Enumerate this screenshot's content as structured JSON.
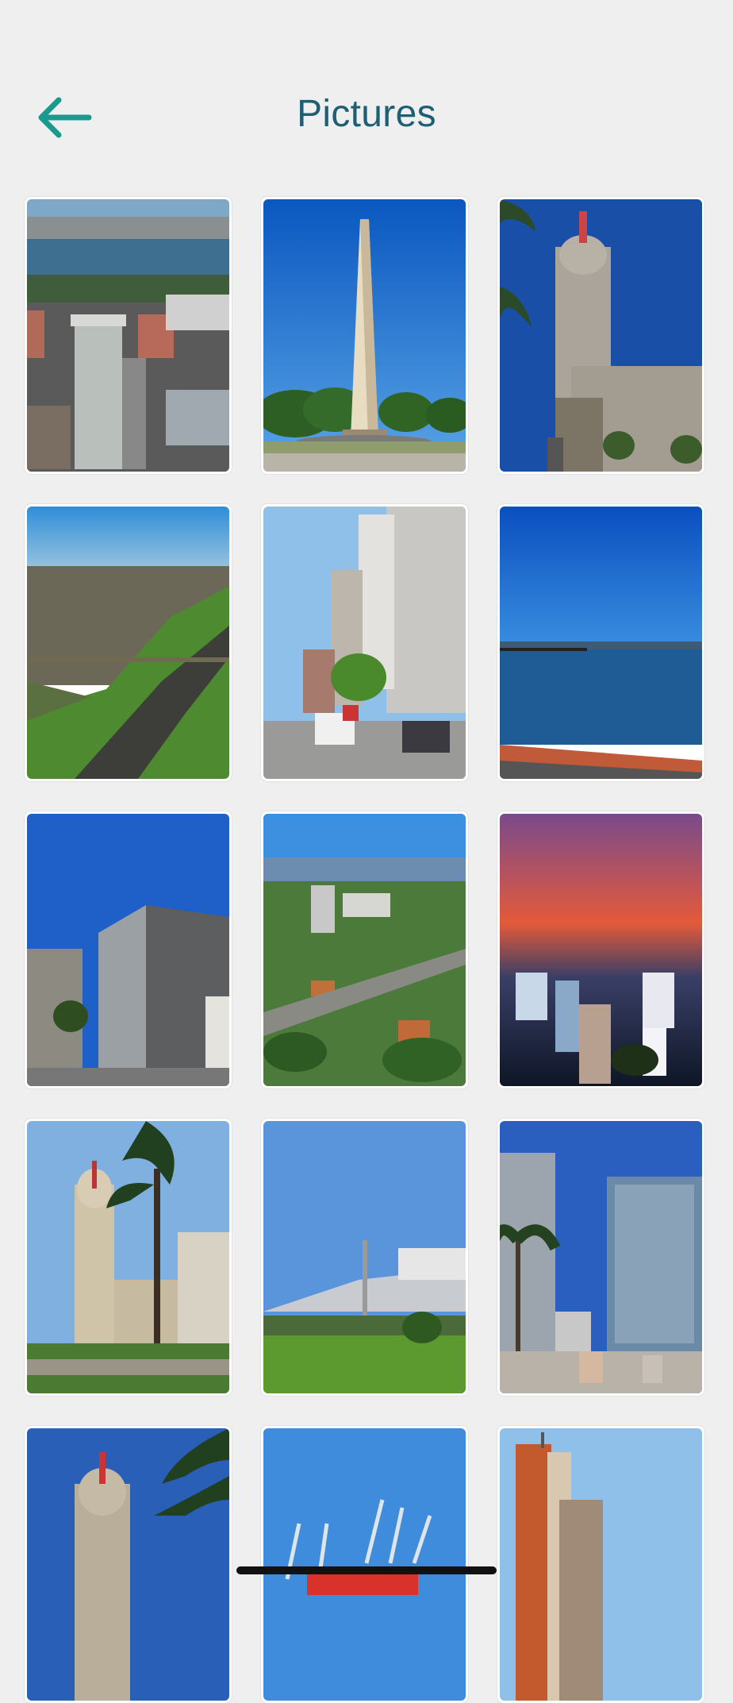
{
  "header": {
    "title": "Pictures",
    "back_icon": "arrow-left-icon",
    "accent_color": "#1a9a8e",
    "title_color": "#1d5f74"
  },
  "gallery": {
    "items": [
      {
        "subject": "aerial-city-bay"
      },
      {
        "subject": "obelisk-monument"
      },
      {
        "subject": "salvo-palace"
      },
      {
        "subject": "coastline-aerial"
      },
      {
        "subject": "street-buildings"
      },
      {
        "subject": "harbor-water"
      },
      {
        "subject": "office-buildings"
      },
      {
        "subject": "aerial-residential"
      },
      {
        "subject": "city-sunset"
      },
      {
        "subject": "palace-plaza-palms"
      },
      {
        "subject": "fortress-hill"
      },
      {
        "subject": "plaza-towers"
      },
      {
        "subject": "palace-tower-palm"
      },
      {
        "subject": "port-cranes"
      },
      {
        "subject": "modern-tower"
      }
    ]
  }
}
